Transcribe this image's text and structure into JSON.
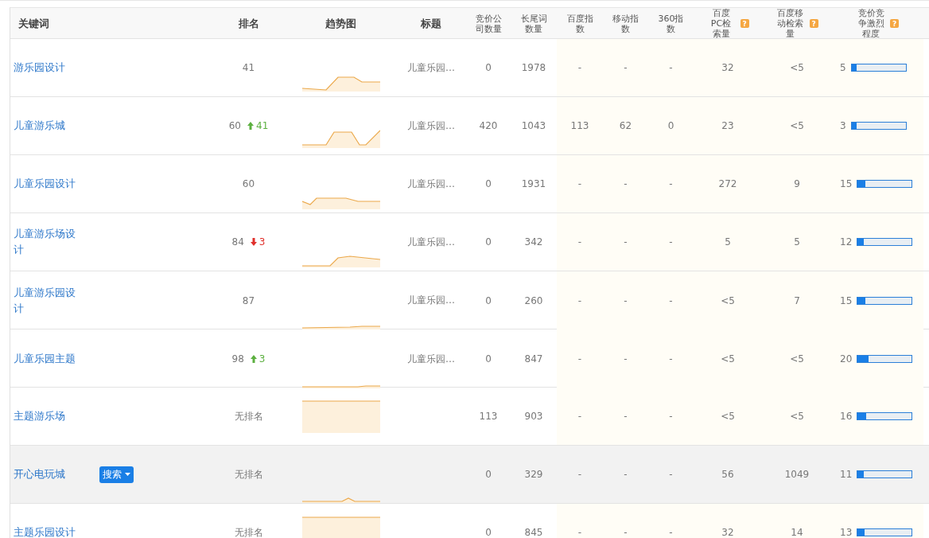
{
  "columns": [
    {
      "label": "关键词"
    },
    {
      "label": "排名"
    },
    {
      "label": "趋势图"
    },
    {
      "label": "标题"
    },
    {
      "label": "竞价公司数量"
    },
    {
      "label": "长尾词数量"
    },
    {
      "label": "百度指数"
    },
    {
      "label": "移动指数"
    },
    {
      "label": "360指数"
    },
    {
      "label": "百度PC检索量",
      "hint": "?"
    },
    {
      "label": "百度移动检索量",
      "hint": "?"
    },
    {
      "label": "竞价竞争激烈程度",
      "hint": "?"
    }
  ],
  "rows": [
    {
      "keyword": "游乐园设计",
      "rank": "41",
      "title": "儿童乐园…",
      "bid_companies": "0",
      "longtail": "1978",
      "baidu_index": "-",
      "mobile_index": "-",
      "index_360": "-",
      "pc_volume": "32",
      "mobile_volume": "<5",
      "competition": "5",
      "level": 0.05,
      "hovered": false
    },
    {
      "keyword": "儿童游乐城",
      "rank": "60",
      "change": {
        "kind": "up",
        "amount": "41"
      },
      "title": "儿童乐园…",
      "bid_companies": "420",
      "longtail": "1043",
      "baidu_index": "113",
      "mobile_index": "62",
      "index_360": "0",
      "pc_volume": "23",
      "mobile_volume": "<5",
      "competition": "3",
      "level": 0.03,
      "hovered": false
    },
    {
      "keyword": "儿童乐园设计",
      "rank": "60",
      "title": "儿童乐园…",
      "bid_companies": "0",
      "longtail": "1931",
      "baidu_index": "-",
      "mobile_index": "-",
      "index_360": "-",
      "pc_volume": "272",
      "mobile_volume": "9",
      "competition": "15",
      "level": 0.15,
      "hovered": false
    },
    {
      "keyword": "儿童游乐场设计",
      "rank": "84",
      "change": {
        "kind": "down",
        "amount": "3"
      },
      "title": "儿童乐园…",
      "bid_companies": "0",
      "longtail": "342",
      "baidu_index": "-",
      "mobile_index": "-",
      "index_360": "-",
      "pc_volume": "5",
      "mobile_volume": "5",
      "competition": "12",
      "level": 0.12,
      "hovered": false
    },
    {
      "keyword": "儿童游乐园设计",
      "rank": "87",
      "title": "儿童乐园…",
      "bid_companies": "0",
      "longtail": "260",
      "baidu_index": "-",
      "mobile_index": "-",
      "index_360": "-",
      "pc_volume": "<5",
      "mobile_volume": "7",
      "competition": "15",
      "level": 0.15,
      "hovered": false
    },
    {
      "keyword": "儿童乐园主题",
      "rank": "98",
      "change": {
        "kind": "up",
        "amount": "3"
      },
      "title": "儿童乐园…",
      "bid_companies": "0",
      "longtail": "847",
      "baidu_index": "-",
      "mobile_index": "-",
      "index_360": "-",
      "pc_volume": "<5",
      "mobile_volume": "<5",
      "competition": "20",
      "level": 0.2,
      "hovered": false
    },
    {
      "keyword": "主题游乐场",
      "rank": "无排名",
      "bid_companies": "113",
      "longtail": "903",
      "baidu_index": "-",
      "mobile_index": "-",
      "index_360": "-",
      "pc_volume": "<5",
      "mobile_volume": "<5",
      "competition": "16",
      "level": 0.16,
      "hovered": false
    },
    {
      "keyword": "开心电玩城",
      "action": "搜索",
      "rank": "无排名",
      "bid_companies": "0",
      "longtail": "329",
      "baidu_index": "-",
      "mobile_index": "-",
      "index_360": "-",
      "pc_volume": "56",
      "mobile_volume": "1049",
      "competition": "11",
      "level": 0.11,
      "hovered": true
    },
    {
      "keyword": "主题乐园设计",
      "rank": "无排名",
      "bid_companies": "0",
      "longtail": "845",
      "baidu_index": "-",
      "mobile_index": "-",
      "index_360": "-",
      "pc_volume": "32",
      "mobile_volume": "14",
      "competition": "13",
      "level": 0.13,
      "hovered": false
    }
  ]
}
